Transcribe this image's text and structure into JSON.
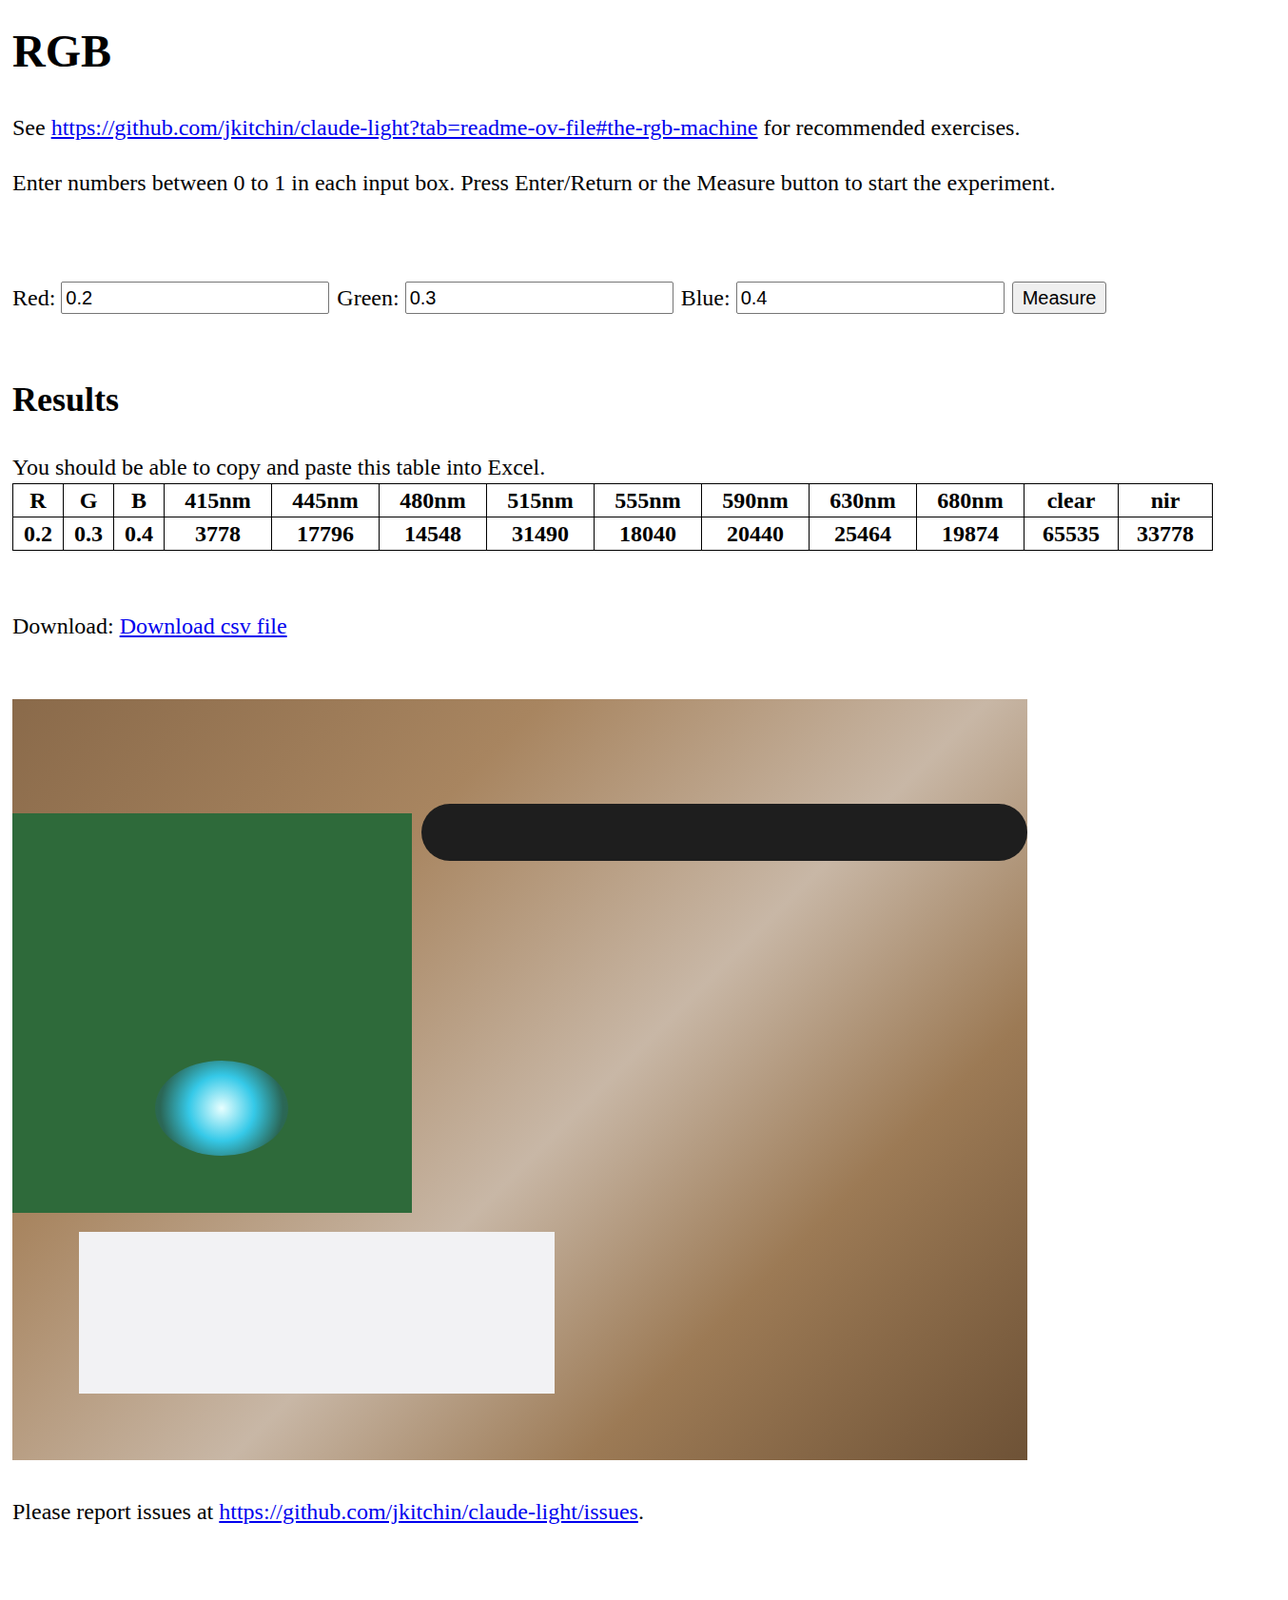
{
  "page": {
    "title": "RGB",
    "intro": {
      "before": "See ",
      "link": "https://github.com/jkitchin/claude-light?tab=readme-ov-file#the-rgb-machine",
      "after": " for recommended exercises."
    },
    "instructions": "Enter numbers between 0 to 1 in each input box. Press Enter/Return or the Measure button to start the experiment."
  },
  "form": {
    "fields": [
      {
        "label": "Red:",
        "value": "0.2"
      },
      {
        "label": "Green:",
        "value": "0.3"
      },
      {
        "label": "Blue:",
        "value": "0.4"
      }
    ],
    "button": "Measure"
  },
  "results": {
    "heading": "Results",
    "note": "You should be able to copy and paste this table into Excel.",
    "table": {
      "columns": [
        "R",
        "G",
        "B",
        "415nm",
        "445nm",
        "480nm",
        "515nm",
        "555nm",
        "590nm",
        "630nm",
        "680nm",
        "clear",
        "nir"
      ],
      "rows": [
        [
          "0.2",
          "0.3",
          "0.4",
          "3778",
          "17796",
          "14548",
          "31490",
          "18040",
          "20440",
          "25464",
          "19874",
          "65535",
          "33778"
        ]
      ]
    }
  },
  "download": {
    "label": "Download: ",
    "link": "Download csv file"
  },
  "footer": {
    "before": "Please report issues at ",
    "link": "https://github.com/jkitchin/claude-light/issues",
    "after": "."
  }
}
